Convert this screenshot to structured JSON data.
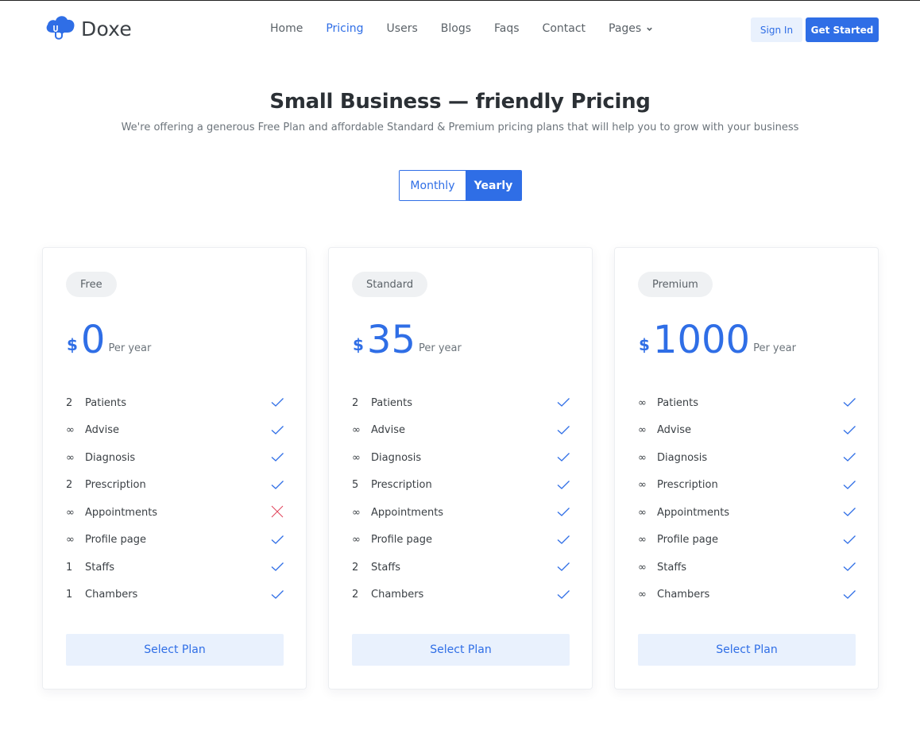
{
  "brand": {
    "name": "Doxe",
    "color": "#2f6ee6",
    "logo_icon": "cloud-stethoscope-icon"
  },
  "nav": {
    "items": [
      {
        "label": "Home",
        "active": false
      },
      {
        "label": "Pricing",
        "active": true
      },
      {
        "label": "Users",
        "active": false
      },
      {
        "label": "Blogs",
        "active": false
      },
      {
        "label": "Faqs",
        "active": false
      },
      {
        "label": "Contact",
        "active": false
      },
      {
        "label": "Pages",
        "active": false,
        "has_dropdown": true
      }
    ],
    "sign_in": "Sign In",
    "get_started": "Get Started"
  },
  "hero": {
    "title": "Small Business — friendly Pricing",
    "subtitle": "We're offering a generous Free Plan and affordable Standard & Premium pricing plans that will help you to grow with your business"
  },
  "billing_toggle": {
    "monthly": "Monthly",
    "yearly": "Yearly",
    "selected": "yearly"
  },
  "plans": [
    {
      "name": "Free",
      "currency": "$",
      "amount": "0",
      "period": "Per year",
      "button": "Select Plan",
      "features": [
        {
          "count": "2",
          "label": "Patients",
          "included": true
        },
        {
          "count": "∞",
          "label": "Advise",
          "included": true
        },
        {
          "count": "∞",
          "label": "Diagnosis",
          "included": true
        },
        {
          "count": "2",
          "label": "Prescription",
          "included": true
        },
        {
          "count": "∞",
          "label": "Appointments",
          "included": false
        },
        {
          "count": "∞",
          "label": "Profile page",
          "included": true
        },
        {
          "count": "1",
          "label": "Staffs",
          "included": true
        },
        {
          "count": "1",
          "label": "Chambers",
          "included": true
        }
      ]
    },
    {
      "name": "Standard",
      "currency": "$",
      "amount": "35",
      "period": "Per year",
      "button": "Select Plan",
      "features": [
        {
          "count": "2",
          "label": "Patients",
          "included": true
        },
        {
          "count": "∞",
          "label": "Advise",
          "included": true
        },
        {
          "count": "∞",
          "label": "Diagnosis",
          "included": true
        },
        {
          "count": "5",
          "label": "Prescription",
          "included": true
        },
        {
          "count": "∞",
          "label": "Appointments",
          "included": true
        },
        {
          "count": "∞",
          "label": "Profile page",
          "included": true
        },
        {
          "count": "2",
          "label": "Staffs",
          "included": true
        },
        {
          "count": "2",
          "label": "Chambers",
          "included": true
        }
      ]
    },
    {
      "name": "Premium",
      "currency": "$",
      "amount": "1000",
      "period": "Per year",
      "button": "Select Plan",
      "features": [
        {
          "count": "∞",
          "label": "Patients",
          "included": true
        },
        {
          "count": "∞",
          "label": "Advise",
          "included": true
        },
        {
          "count": "∞",
          "label": "Diagnosis",
          "included": true
        },
        {
          "count": "∞",
          "label": "Prescription",
          "included": true
        },
        {
          "count": "∞",
          "label": "Appointments",
          "included": true
        },
        {
          "count": "∞",
          "label": "Profile page",
          "included": true
        },
        {
          "count": "∞",
          "label": "Staffs",
          "included": true
        },
        {
          "count": "∞",
          "label": "Chambers",
          "included": true
        }
      ]
    }
  ],
  "colors": {
    "accent": "#2f6ee6",
    "check": "#2f6ee6",
    "cross": "#e0435a",
    "soft_blue": "#e9f1fd"
  }
}
